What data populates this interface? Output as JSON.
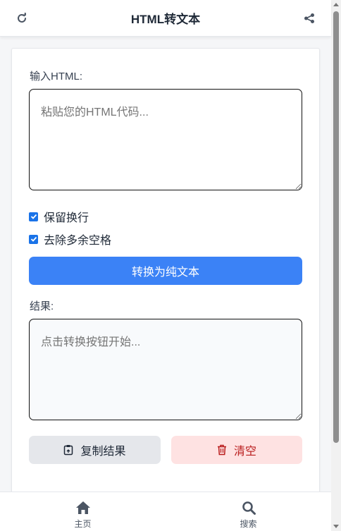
{
  "header": {
    "title": "HTML转文本",
    "refresh_icon": "refresh-icon",
    "share_icon": "share-icon"
  },
  "form": {
    "input_label": "输入HTML:",
    "input_placeholder": "粘贴您的HTML代码...",
    "input_value": "",
    "options": [
      {
        "label": "保留换行",
        "checked": true
      },
      {
        "label": "去除多余空格",
        "checked": true
      }
    ],
    "convert_button": "转换为纯文本",
    "result_label": "结果:",
    "result_placeholder": "点击转换按钮开始...",
    "result_value": "",
    "copy_button": "复制结果",
    "clear_button": "清空"
  },
  "bottom_nav": {
    "items": [
      {
        "label": "主页",
        "icon": "home-icon"
      },
      {
        "label": "搜索",
        "icon": "search-icon"
      }
    ]
  },
  "colors": {
    "primary": "#3b82f6",
    "checkbox": "#1a73e8",
    "clear_bg": "#fee2e2",
    "clear_text": "#b91c1c",
    "copy_bg": "#e5e7eb"
  }
}
